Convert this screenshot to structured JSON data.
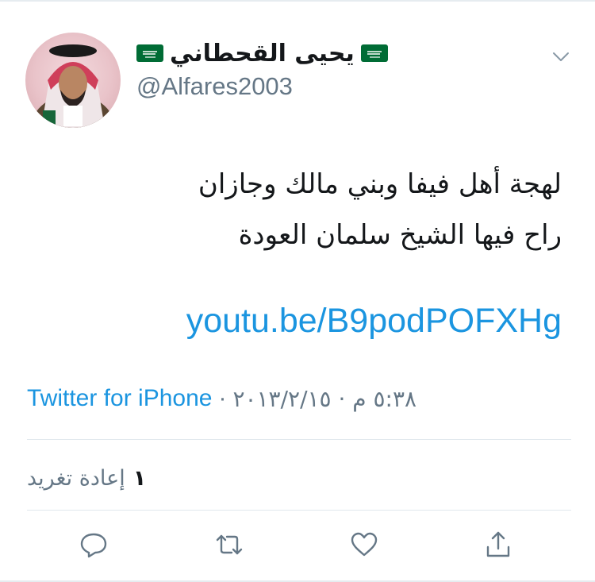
{
  "tweet": {
    "author": {
      "name": "يحيى القحطاني",
      "handle": "@Alfares2003"
    },
    "text_lines": [
      "لهجة أهل فيفا وبني مالك وجازان",
      "راح فيها الشيخ سلمان العودة"
    ],
    "link": "youtu.be/B9podPOFXHg",
    "source": "Twitter for iPhone",
    "meta_separator": "·",
    "datetime": "٥:٣٨ م · ٢٠١٣/٢/١٥",
    "retweet_label": "إعادة تغريد",
    "retweet_count": "١"
  },
  "icons": {
    "name_flags": "saudi-flag-emoji",
    "menu": "chevron-down-icon",
    "actions": [
      "reply-icon",
      "retweet-icon",
      "like-icon",
      "share-icon"
    ]
  },
  "colors": {
    "link": "#1b95e0",
    "secondary_text": "#657786",
    "primary_text": "#14171a",
    "icon": "#657786",
    "flag_green": "#006c35"
  }
}
